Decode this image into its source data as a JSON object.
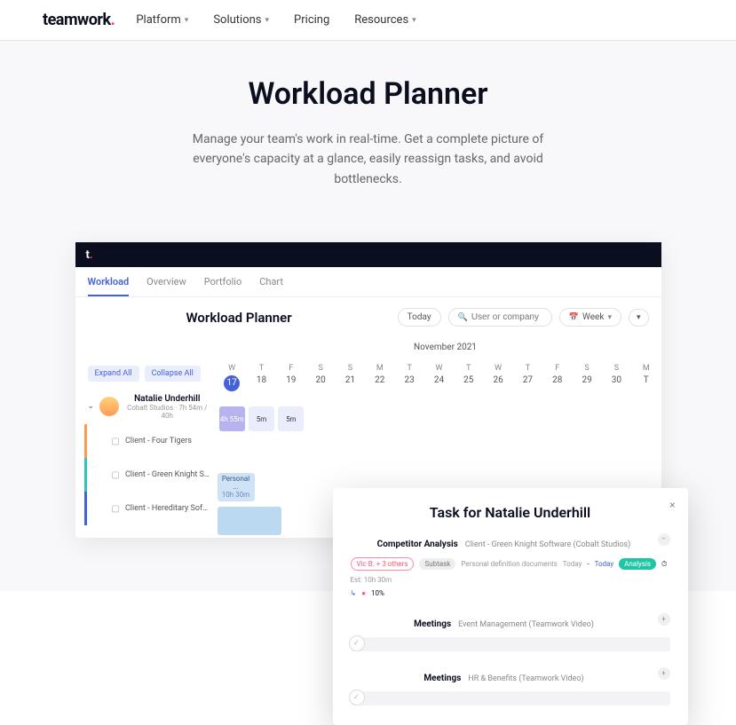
{
  "nav": {
    "logo_main": "teamwork",
    "logo_dot": ".",
    "items": [
      "Platform",
      "Solutions",
      "Pricing",
      "Resources"
    ]
  },
  "hero": {
    "title": "Workload Planner",
    "subtitle": "Manage your team's work in real-time. Get a complete picture of everyone's capacity at a glance, easily reassign tasks, and avoid bottlenecks."
  },
  "app": {
    "tabs": [
      "Workload",
      "Overview",
      "Portfolio",
      "Chart"
    ],
    "title": "Workload Planner",
    "today_btn": "Today",
    "search_placeholder": "User or company",
    "week_btn": "Week",
    "month_label": "November 2021",
    "expand_all": "Expand All",
    "collapse_all": "Collapse All",
    "days": [
      {
        "d": "W",
        "n": "17",
        "today": true
      },
      {
        "d": "T",
        "n": "18"
      },
      {
        "d": "F",
        "n": "19"
      },
      {
        "d": "S",
        "n": "20"
      },
      {
        "d": "S",
        "n": "21"
      },
      {
        "d": "M",
        "n": "22"
      },
      {
        "d": "T",
        "n": "23"
      },
      {
        "d": "W",
        "n": "24"
      },
      {
        "d": "T",
        "n": "25"
      },
      {
        "d": "W",
        "n": "26"
      },
      {
        "d": "T",
        "n": "27"
      },
      {
        "d": "F",
        "n": "28"
      },
      {
        "d": "S",
        "n": "29"
      },
      {
        "d": "S",
        "n": "30"
      },
      {
        "d": "M",
        "n": "T"
      }
    ],
    "person": {
      "name": "Natalie Underhill",
      "sub": "Cobalt Studios · 7h 54m / 40h",
      "allocs": [
        "4h 55m",
        "5m",
        "5m"
      ]
    },
    "clients": [
      {
        "name": "Client - Four Tigers",
        "color": "c-orange"
      },
      {
        "name": "Client - Green Knight S...",
        "color": "c-teal",
        "task": {
          "title": "Personal ...",
          "dur": "10h 30m"
        }
      },
      {
        "name": "Client - Hereditary Soft...",
        "color": "c-blue"
      }
    ]
  },
  "popup": {
    "title": "Task for Natalie Underhill",
    "sections": [
      {
        "title": "Competitor Analysis",
        "sub": "Client - Green Knight Software (Cobalt Studios)",
        "chip_out": "Vic B. + 3 others",
        "chip_gray": "Subtask",
        "desc": "Personal definition documents",
        "date1": "Today",
        "date2": "Today",
        "chip_teal": "Analysis",
        "est": "Est: 10h 30m",
        "progress": "10%"
      },
      {
        "title": "Meetings",
        "sub": "Event Management  (Teamwork Video)"
      },
      {
        "title": "Meetings",
        "sub": "HR & Benefits  (Teamwork Video)"
      }
    ]
  }
}
